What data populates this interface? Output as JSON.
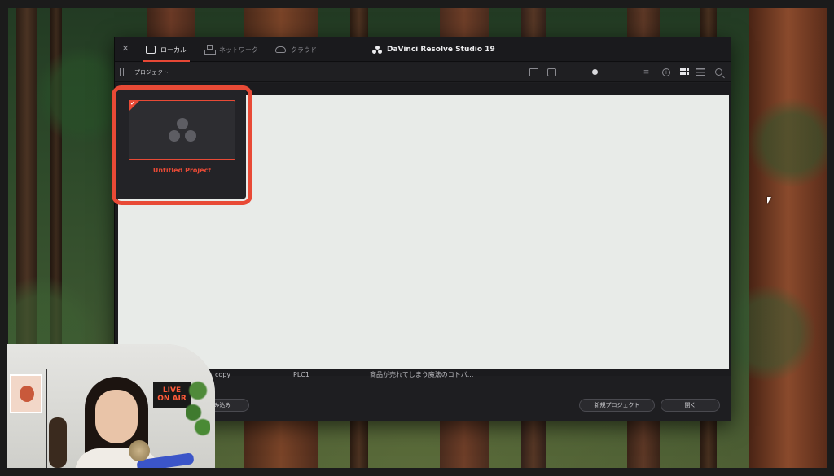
{
  "app": {
    "title": "DaVinci Resolve Studio 19"
  },
  "tabs": [
    {
      "label": "ローカル",
      "active": true,
      "icon": "drive-icon"
    },
    {
      "label": "ネットワーク",
      "active": false,
      "icon": "network-icon"
    },
    {
      "label": "クラウド",
      "active": false,
      "icon": "cloud-icon"
    }
  ],
  "toolbar": {
    "breadcrumb": "プロジェクト",
    "icons": [
      "sidebar-toggle-icon",
      "new-folder-icon",
      "monitor-icon",
      "zoom-slider",
      "sort-icon",
      "info-icon",
      "grid-view-icon",
      "list-view-icon",
      "search-icon"
    ]
  },
  "project_card": {
    "name": "Untitled Project",
    "selected": true
  },
  "list_row": {
    "name": "copy",
    "resolution": "PLC1",
    "note": "商品が売れてしまう魔法のコトバ..."
  },
  "buttons": {
    "import_label": "み込み",
    "new_project_label": "新規プロジェクト",
    "open_label": "開く"
  },
  "webcam": {
    "sign_line1": "LIVE",
    "sign_line2": "ON AIR"
  },
  "colors": {
    "accent": "#e84a36",
    "window_bg": "#1e1e21",
    "overlay": "#e8ebe8"
  }
}
